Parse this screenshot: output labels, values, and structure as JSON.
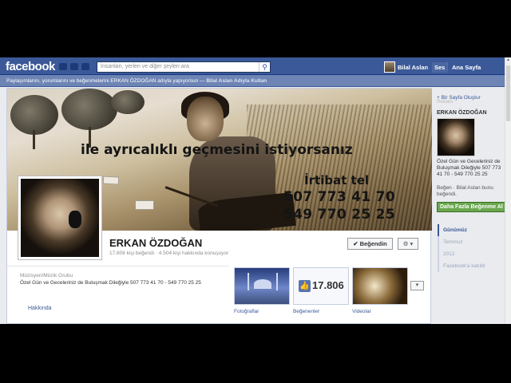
{
  "topbar": {
    "logo": "facebook",
    "search_placeholder": "İnsanları, yerleri ve diğer şeyleri ara",
    "user_name": "Bilal Aslan",
    "nav_active": "Ses",
    "nav_home": "Ana Sayfa"
  },
  "notice": {
    "text": "Paylaşımlarını, yorumlarını ve beğenmelerini ERKAN ÖZDOĞAN adıyla yapıyorsun — ",
    "link": "Bilal Aslan Adıyla Kullan"
  },
  "cover": {
    "slogan": "ile ayrıcalıklı geçmesini istiyorsanız",
    "contact_label": "İrtibat tel",
    "phone1": "507 773 41 70",
    "phone2": "549 770 25 25"
  },
  "profile": {
    "name": "ERKAN ÖZDOĞAN",
    "stats": "17.806 kişi beğendi · 4.504 kişi hakkında konuşuyor",
    "like_button": "✔ Beğendin",
    "settings_button": "⚙ ▾",
    "category": "Müzisyen/Müzik Grubu",
    "description": "Özel Gün ve Geceleriniz de Buluşmak Dileğiyle 507 773 41 70 - 549 770 25 25",
    "about_tab": "Hakkında"
  },
  "apps": {
    "photos_label": "Fotoğraflar",
    "likes_label": "Beğenenler",
    "likes_count": "17.806",
    "videos_label": "Videolar",
    "more": "▾"
  },
  "rightcol": {
    "create_page": "+ Bir Sayfa Oluştur",
    "hidden_text": "Reklam",
    "name": "ERKAN ÖZDOĞAN",
    "desc": "Özel Gün ve Geceleriniz de Buluşmak Dileğiyle 507 773 41 70 - 549 770 25 25",
    "like_prefix": "Beğen · Bilal Aslan bunu beğendi.",
    "more_likes": "Daha Fazla Beğenme Al",
    "timeline": [
      "Günümüz",
      "Temmuz",
      "2012",
      "Facebook'a katıldı"
    ]
  },
  "colors": {
    "facebook_blue": "#3b5998",
    "green_button": "#69a74e"
  }
}
